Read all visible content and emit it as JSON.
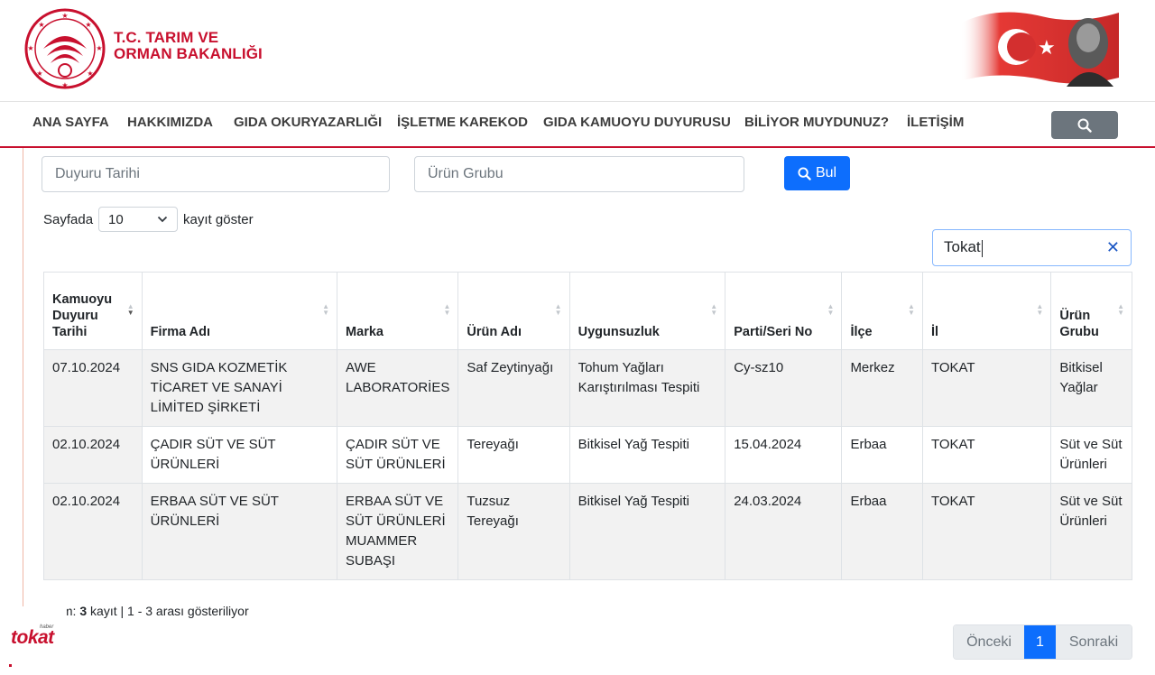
{
  "header": {
    "org_line1": "T.C. TARIM VE",
    "org_line2": "ORMAN BAKANLIĞI"
  },
  "nav": {
    "items": [
      "ANA SAYFA",
      "HAKKIMIZDA",
      "GIDA OKURYAZARLIĞI",
      "İŞLETME KAREKOD",
      "GIDA KAMUOYU DUYURUSU",
      "BİLİYOR MUYDUNUZ?",
      "İLETİŞİM"
    ],
    "search_icon": "search-icon"
  },
  "filters": {
    "date_placeholder": "Duyuru Tarihi",
    "group_placeholder": "Ürün Grubu",
    "find_label": "Bul"
  },
  "page_length": {
    "prefix": "Sayfada",
    "value": "10",
    "suffix": "kayıt göster"
  },
  "search": {
    "value": "Tokat"
  },
  "table": {
    "headers": [
      "Kamuoyu Duyuru Tarihi",
      "Firma Adı",
      "Marka",
      "Ürün Adı",
      "Uygunsuzluk",
      "Parti/Seri No",
      "İlçe",
      "İl",
      "Ürün Grubu"
    ],
    "rows": [
      [
        "07.10.2024",
        "SNS GIDA KOZMETİK TİCARET VE SANAYİ LİMİTED ŞİRKETİ",
        "AWE LABORATORİES",
        "Saf Zeytinyağı",
        "Tohum Yağları Karıştırılması Tespiti",
        "Cy-sz10",
        "Merkez",
        "TOKAT",
        "Bitkisel Yağlar"
      ],
      [
        "02.10.2024",
        "ÇADIR SÜT VE SÜT ÜRÜNLERİ",
        "ÇADIR SÜT VE SÜT ÜRÜNLERİ",
        "Tereyağı",
        "Bitkisel Yağ Tespiti",
        "15.04.2024",
        "Erbaa",
        "TOKAT",
        "Süt ve Süt Ürünleri"
      ],
      [
        "02.10.2024",
        "ERBAA SÜT VE SÜT ÜRÜNLERİ",
        "ERBAA SÜT VE SÜT ÜRÜNLERİ MUAMMER SUBAŞI",
        "Tuzsuz Tereyağı",
        "Bitkisel Yağ Tespiti",
        "24.03.2024",
        "Erbaa",
        "TOKAT",
        "Süt ve Süt Ürünleri"
      ]
    ]
  },
  "info": {
    "prefix": "lam:",
    "count": "3",
    "suffix": "kayıt | 1 - 3 arası gösteriliyor"
  },
  "pagination": {
    "prev": "Önceki",
    "current": "1",
    "next": "Sonraki"
  },
  "watermark": {
    "small": "haber",
    "main": "tokat"
  },
  "colors": {
    "brand_red": "#c8102e",
    "primary_blue": "#0d6efd",
    "nav_search_gray": "#6c757d"
  }
}
